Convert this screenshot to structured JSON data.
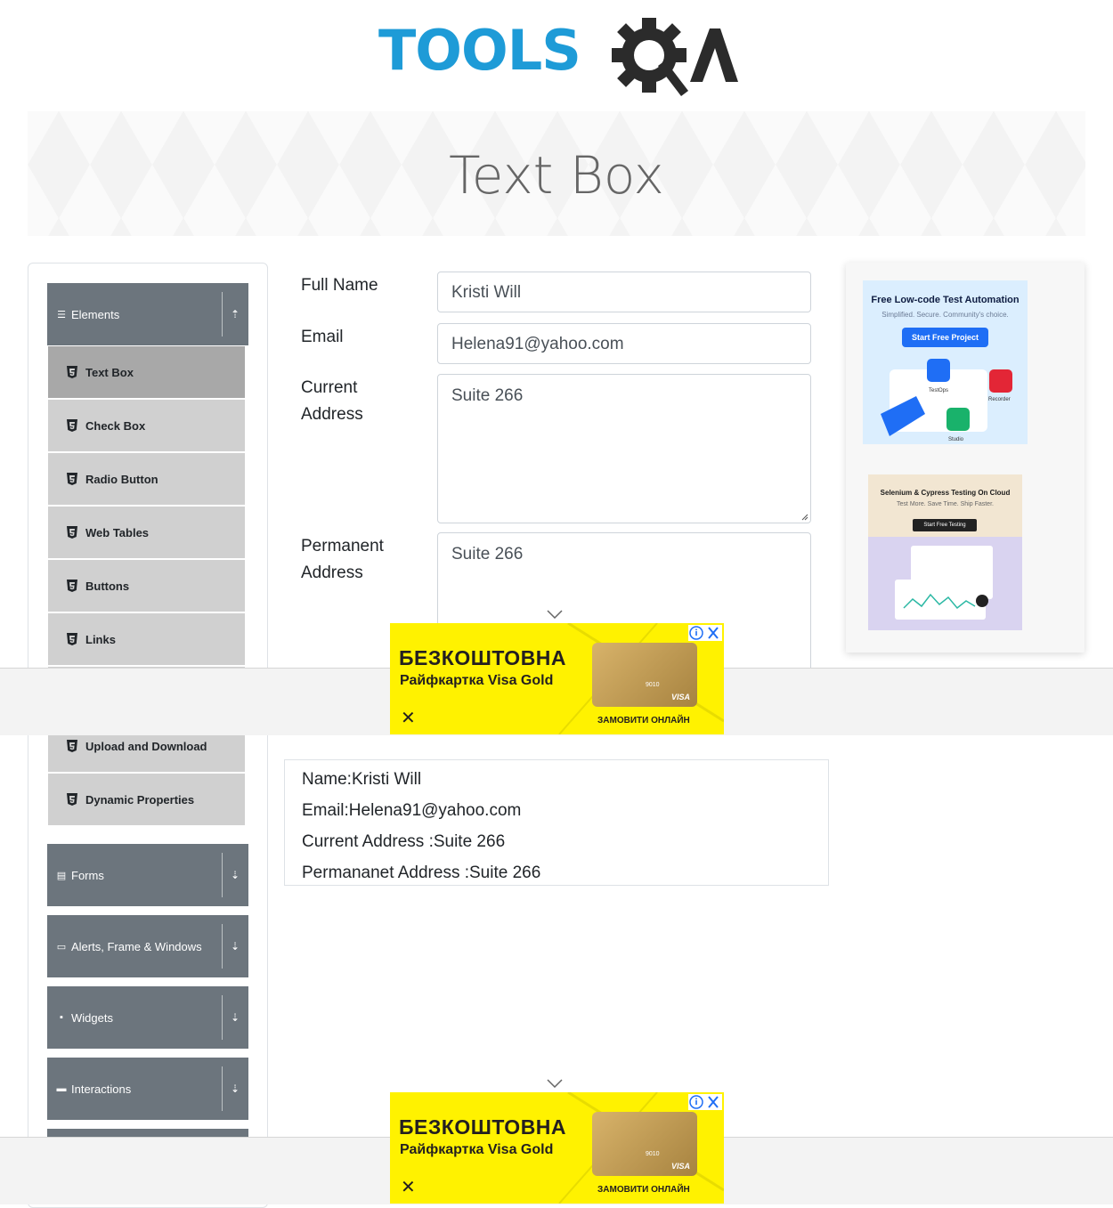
{
  "header": {
    "logo_text": "TOOLS",
    "logo_suffix": "QA"
  },
  "banner": {
    "title": "Text Box"
  },
  "sidebar": {
    "groups": [
      {
        "label": "Elements",
        "icon": "list-icon",
        "arrow": "collapse-up-icon"
      },
      {
        "label": "Forms",
        "icon": "form-icon",
        "arrow": "expand-down-icon"
      },
      {
        "label": "Alerts, Frame & Windows",
        "icon": "window-icon",
        "arrow": "expand-down-icon"
      },
      {
        "label": "Widgets",
        "icon": "grid-icon",
        "arrow": "expand-down-icon"
      },
      {
        "label": "Interactions",
        "icon": "interaction-icon",
        "arrow": "expand-down-icon"
      }
    ],
    "items": [
      {
        "label": "Text Box",
        "active": true
      },
      {
        "label": "Check Box"
      },
      {
        "label": "Radio Button"
      },
      {
        "label": "Web Tables"
      },
      {
        "label": "Buttons"
      },
      {
        "label": "Links"
      },
      {
        "label": "Upload and Download"
      },
      {
        "label": "Dynamic Properties"
      }
    ]
  },
  "form": {
    "full_name": {
      "label": "Full Name",
      "value": "Kristi Will"
    },
    "email": {
      "label": "Email",
      "value": "Helena91@yahoo.com"
    },
    "current_address": {
      "label_line1": "Current",
      "label_line2": "Address",
      "value": "Suite 266"
    },
    "permanent_address": {
      "label_line1": "Permanent",
      "label_line2": "Address",
      "value": "Suite 266"
    }
  },
  "output": {
    "name": "Name:Kristi Will",
    "email": "Email:Helena91@yahoo.com",
    "current_address": "Current Address :Suite 266",
    "permanent_address": "Permananet Address :Suite 266"
  },
  "ads": {
    "right_top": {
      "title": "Free Low-code Test Automation",
      "subtitle": "Simplified. Secure. Community's choice.",
      "button": "Start Free Project",
      "labels": [
        "TestOps",
        "Recorder",
        "Studio"
      ]
    },
    "right_bottom": {
      "title": "Selenium & Cypress Testing On Cloud",
      "subtitle": "Test More. Save Time. Ship Faster.",
      "button": "Start Free Testing"
    },
    "footer": {
      "headline": "БЕЗКОШТОВНА",
      "subline": "Райфкартка Visa Gold",
      "cta": "ЗАМОВИТИ ОНЛАЙН",
      "card_brand": "VISA",
      "card_number": "9010"
    }
  },
  "colors": {
    "logo_blue": "#1e9bd7",
    "logo_dark": "#2b2b2b",
    "group_header": "#6c757d",
    "menu_item": "#d0d0d0",
    "menu_item_active": "#a8a8a8",
    "ad_yellow": "#fff200"
  }
}
